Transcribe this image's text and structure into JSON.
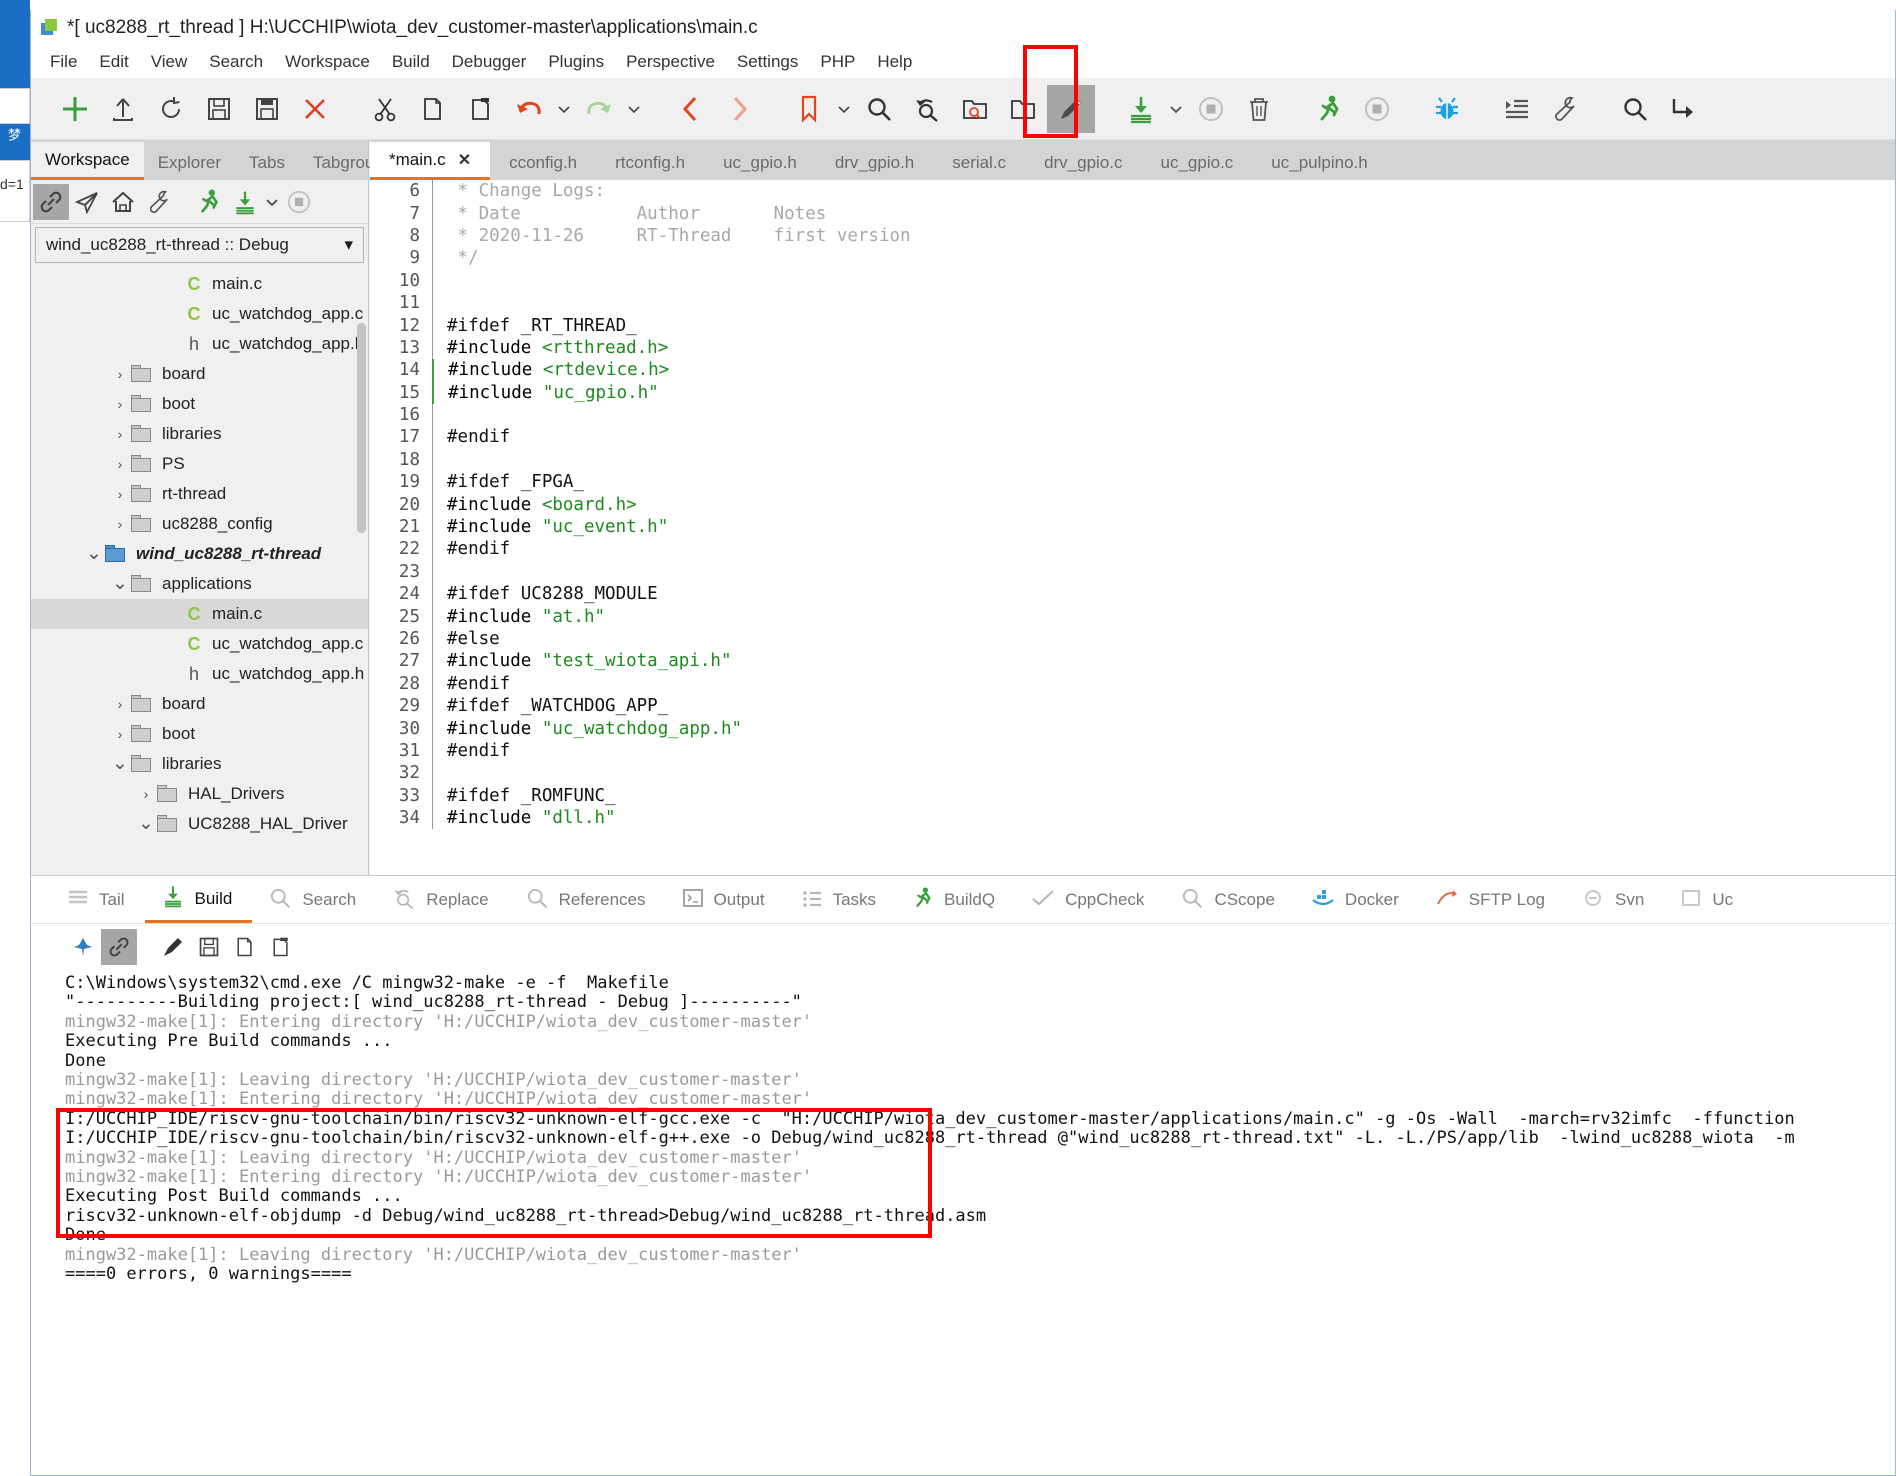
{
  "desktop": {
    "vertical_text": "梦",
    "partial_text": "d=1"
  },
  "window": {
    "title": "*[ uc8288_rt_thread ] H:\\UCCHIP\\wiota_dev_customer-master\\applications\\main.c",
    "icon": "app-icon"
  },
  "menubar": {
    "items": [
      "File",
      "Edit",
      "View",
      "Search",
      "Workspace",
      "Build",
      "Debugger",
      "Plugins",
      "Perspective",
      "Settings",
      "PHP",
      "Help"
    ]
  },
  "toolbar": {
    "items": [
      {
        "name": "new-file-button",
        "icon": "plus-icon",
        "color": "#3a9e3a"
      },
      {
        "name": "open-file-button",
        "icon": "upload-icon",
        "color": "#444444"
      },
      {
        "name": "reload-button",
        "icon": "refresh-icon",
        "color": "#444444"
      },
      {
        "name": "save-button",
        "icon": "save-icon",
        "color": "#444444"
      },
      {
        "name": "save-all-button",
        "icon": "save-all-icon",
        "color": "#444444"
      },
      {
        "name": "close-file-button",
        "icon": "close-x-icon",
        "color": "#e03c20"
      },
      {
        "name": "cut-button",
        "icon": "scissors-icon",
        "color": "#333333"
      },
      {
        "name": "copy-button",
        "icon": "copy-icon",
        "color": "#333333"
      },
      {
        "name": "paste-button",
        "icon": "paste-icon",
        "color": "#333333"
      },
      {
        "name": "undo-button",
        "icon": "undo-arrow-icon",
        "color": "#e0451e"
      },
      {
        "name": "redo-button",
        "icon": "redo-arrow-icon",
        "color": "#a8d49a"
      },
      {
        "name": "nav-back-button",
        "icon": "chevron-left-icon",
        "color": "#e0451e"
      },
      {
        "name": "nav-forward-button",
        "icon": "chevron-right-icon",
        "color": "#f0a189"
      },
      {
        "name": "bookmark-button",
        "icon": "bookmark-icon",
        "color": "#e0451e"
      },
      {
        "name": "find-button",
        "icon": "search-icon",
        "color": "#333333"
      },
      {
        "name": "replace-button",
        "icon": "find-replace-icon",
        "color": "#333333"
      },
      {
        "name": "find-in-files-button",
        "icon": "folder-search-icon",
        "color": "#333333"
      },
      {
        "name": "open-folder-button",
        "icon": "folder-open-icon",
        "color": "#333333"
      },
      {
        "name": "edit-mode-button",
        "icon": "pencil-icon",
        "color": "#4a4a4a"
      },
      {
        "name": "build-download-button",
        "icon": "download-build-icon",
        "color": "#3a9e3a"
      },
      {
        "name": "stop-build-button",
        "icon": "stop-circle-icon",
        "color": "#b0b0b0"
      },
      {
        "name": "clean-button",
        "icon": "trash-icon",
        "color": "#555555"
      },
      {
        "name": "run-button",
        "icon": "runner-icon",
        "color": "#3a9e3a"
      },
      {
        "name": "stop-run-button",
        "icon": "stop-circle-icon",
        "color": "#b0b0b0"
      },
      {
        "name": "debug-button",
        "icon": "bug-icon",
        "color": "#1e9fe0"
      },
      {
        "name": "indent-button",
        "icon": "indent-icon",
        "color": "#555555"
      },
      {
        "name": "settings-button",
        "icon": "wrench-icon",
        "color": "#555555"
      },
      {
        "name": "search2-button",
        "icon": "search-icon",
        "color": "#333333"
      },
      {
        "name": "goto-button",
        "icon": "goto-arrow-icon",
        "color": "#333333"
      }
    ],
    "highlighted_item": "build-download-button"
  },
  "left_panel": {
    "tabs": [
      {
        "label": "Workspace",
        "active": true
      },
      {
        "label": "Explorer",
        "active": false
      },
      {
        "label": "Tabs",
        "active": false
      },
      {
        "label": "Tabgrou",
        "active": false,
        "caret": "⌄"
      }
    ],
    "toolbar": [
      {
        "name": "link-button",
        "icon": "link-icon",
        "selected": true
      },
      {
        "name": "send-button",
        "icon": "paper-plane-icon",
        "selected": false
      },
      {
        "name": "home-button",
        "icon": "home-icon",
        "selected": false
      },
      {
        "name": "configure-button",
        "icon": "wrench-icon",
        "selected": false
      },
      {
        "name": "run-project-button",
        "icon": "runner-icon",
        "selected": false
      },
      {
        "name": "build-project-button",
        "icon": "download-build-icon",
        "selected": false
      },
      {
        "name": "stop-project-button",
        "icon": "stop-circle-icon",
        "selected": false
      }
    ],
    "project_selector": "wind_uc8288_rt-thread :: Debug",
    "tree": [
      {
        "label": "main.c",
        "type": "c",
        "indent": 4,
        "chev": "",
        "sel": false
      },
      {
        "label": "uc_watchdog_app.c",
        "type": "c",
        "indent": 4,
        "chev": "",
        "sel": false
      },
      {
        "label": "uc_watchdog_app.h",
        "type": "h",
        "indent": 4,
        "chev": "",
        "sel": false
      },
      {
        "label": "board",
        "type": "folder",
        "indent": 2,
        "chev": "›",
        "sel": false
      },
      {
        "label": "boot",
        "type": "folder",
        "indent": 2,
        "chev": "›",
        "sel": false
      },
      {
        "label": "libraries",
        "type": "folder",
        "indent": 2,
        "chev": "›",
        "sel": false
      },
      {
        "label": "PS",
        "type": "folder",
        "indent": 2,
        "chev": "›",
        "sel": false
      },
      {
        "label": "rt-thread",
        "type": "folder",
        "indent": 2,
        "chev": "›",
        "sel": false
      },
      {
        "label": "uc8288_config",
        "type": "folder",
        "indent": 2,
        "chev": "›",
        "sel": false
      },
      {
        "label": "wind_uc8288_rt-thread",
        "type": "folder-blue",
        "indent": 1,
        "chev": "⌄",
        "sel": false,
        "bold": true
      },
      {
        "label": "applications",
        "type": "folder",
        "indent": 2,
        "chev": "⌄",
        "sel": false
      },
      {
        "label": "main.c",
        "type": "c",
        "indent": 4,
        "chev": "",
        "sel": true
      },
      {
        "label": "uc_watchdog_app.c",
        "type": "c",
        "indent": 4,
        "chev": "",
        "sel": false
      },
      {
        "label": "uc_watchdog_app.h",
        "type": "h",
        "indent": 4,
        "chev": "",
        "sel": false
      },
      {
        "label": "board",
        "type": "folder",
        "indent": 2,
        "chev": "›",
        "sel": false
      },
      {
        "label": "boot",
        "type": "folder",
        "indent": 2,
        "chev": "›",
        "sel": false
      },
      {
        "label": "libraries",
        "type": "folder",
        "indent": 2,
        "chev": "⌄",
        "sel": false
      },
      {
        "label": "HAL_Drivers",
        "type": "folder",
        "indent": 3,
        "chev": "›",
        "sel": false
      },
      {
        "label": "UC8288_HAL_Driver",
        "type": "folder",
        "indent": 3,
        "chev": "⌄",
        "sel": false
      }
    ]
  },
  "editor": {
    "tabs": [
      {
        "label": "*main.c",
        "active": true,
        "closable": true,
        "close": "✕"
      },
      {
        "label": "cconfig.h",
        "active": false,
        "closable": false
      },
      {
        "label": "rtconfig.h",
        "active": false,
        "closable": false
      },
      {
        "label": "uc_gpio.h",
        "active": false,
        "closable": false
      },
      {
        "label": "drv_gpio.h",
        "active": false,
        "closable": false
      },
      {
        "label": "serial.c",
        "active": false,
        "closable": false
      },
      {
        "label": "drv_gpio.c",
        "active": false,
        "closable": false
      },
      {
        "label": "uc_gpio.c",
        "active": false,
        "closable": false
      },
      {
        "label": "uc_pulpino.h",
        "active": false,
        "closable": false
      }
    ],
    "lines": [
      {
        "num": 6,
        "text": " * Change Logs:",
        "style": "comment",
        "mark": "none"
      },
      {
        "num": 7,
        "text": " * Date           Author       Notes",
        "style": "comment",
        "mark": "none"
      },
      {
        "num": 8,
        "text": " * 2020-11-26     RT-Thread    first version",
        "style": "comment",
        "mark": "none"
      },
      {
        "num": 9,
        "text": " */",
        "style": "comment",
        "mark": "none"
      },
      {
        "num": 10,
        "text": "",
        "style": "code",
        "mark": "none"
      },
      {
        "num": 11,
        "text": "",
        "style": "code",
        "mark": "none"
      },
      {
        "num": 12,
        "text": "#ifdef _RT_THREAD_",
        "style": "code",
        "mark": "none"
      },
      {
        "num": 13,
        "text": "#include <rtthread.h>",
        "style": "include-angle",
        "mark": "none"
      },
      {
        "num": 14,
        "text": "#include <rtdevice.h>",
        "style": "include-angle",
        "mark": "green"
      },
      {
        "num": 15,
        "text": "#include \"uc_gpio.h\"",
        "style": "include-quote",
        "mark": "green"
      },
      {
        "num": 16,
        "text": "",
        "style": "code",
        "mark": "none"
      },
      {
        "num": 17,
        "text": "#endif",
        "style": "code",
        "mark": "none"
      },
      {
        "num": 18,
        "text": "",
        "style": "code",
        "mark": "none"
      },
      {
        "num": 19,
        "text": "#ifdef _FPGA_",
        "style": "code",
        "mark": "none"
      },
      {
        "num": 20,
        "text": "#include <board.h>",
        "style": "include-angle",
        "mark": "none"
      },
      {
        "num": 21,
        "text": "#include \"uc_event.h\"",
        "style": "include-quote",
        "mark": "none"
      },
      {
        "num": 22,
        "text": "#endif",
        "style": "code",
        "mark": "none"
      },
      {
        "num": 23,
        "text": "",
        "style": "code",
        "mark": "none"
      },
      {
        "num": 24,
        "text": "#ifdef UC8288_MODULE",
        "style": "code",
        "mark": "none"
      },
      {
        "num": 25,
        "text": "#include \"at.h\"",
        "style": "include-quote",
        "mark": "none"
      },
      {
        "num": 26,
        "text": "#else",
        "style": "code",
        "mark": "none"
      },
      {
        "num": 27,
        "text": "#include \"test_wiota_api.h\"",
        "style": "include-quote",
        "mark": "none"
      },
      {
        "num": 28,
        "text": "#endif",
        "style": "code",
        "mark": "none"
      },
      {
        "num": 29,
        "text": "#ifdef _WATCHDOG_APP_",
        "style": "code",
        "mark": "none"
      },
      {
        "num": 30,
        "text": "#include \"uc_watchdog_app.h\"",
        "style": "include-quote",
        "mark": "none"
      },
      {
        "num": 31,
        "text": "#endif",
        "style": "code",
        "mark": "none"
      },
      {
        "num": 32,
        "text": "",
        "style": "code",
        "mark": "none"
      },
      {
        "num": 33,
        "text": "#ifdef _ROMFUNC_",
        "style": "code",
        "mark": "none"
      },
      {
        "num": 34,
        "text": "#include \"dll.h\"",
        "style": "include-quote",
        "mark": "none"
      }
    ]
  },
  "bottom_panel": {
    "tabs": [
      {
        "label": "Tail",
        "icon": "list-icon",
        "active": false
      },
      {
        "label": "Build",
        "icon": "download-build-icon",
        "active": true
      },
      {
        "label": "Search",
        "icon": "search-icon",
        "active": false
      },
      {
        "label": "Replace",
        "icon": "find-replace-icon",
        "active": false
      },
      {
        "label": "References",
        "icon": "search-icon",
        "active": false
      },
      {
        "label": "Output",
        "icon": "terminal-icon",
        "active": false
      },
      {
        "label": "Tasks",
        "icon": "tasks-icon",
        "active": false
      },
      {
        "label": "BuildQ",
        "icon": "runner-icon",
        "active": false
      },
      {
        "label": "CppCheck",
        "icon": "check-icon",
        "active": false
      },
      {
        "label": "CScope",
        "icon": "search-icon",
        "active": false
      },
      {
        "label": "Docker",
        "icon": "docker-icon",
        "active": false
      },
      {
        "label": "SFTP Log",
        "icon": "sftp-icon",
        "active": false
      },
      {
        "label": "Svn",
        "icon": "svn-icon",
        "active": false
      },
      {
        "label": "Uc",
        "icon": "uc-icon",
        "active": false
      }
    ],
    "toolbar": [
      {
        "name": "pin-button",
        "icon": "pin-icon",
        "selected": false
      },
      {
        "name": "link-button",
        "icon": "link-icon",
        "selected": true
      },
      {
        "name": "clear-console-button",
        "icon": "broom-icon",
        "selected": false
      },
      {
        "name": "save-console-button",
        "icon": "save-icon",
        "selected": false
      },
      {
        "name": "copy-console-button",
        "icon": "copy-icon",
        "selected": false
      },
      {
        "name": "copy-all-button",
        "icon": "paste-icon",
        "selected": false
      }
    ],
    "console_lines": [
      {
        "text": "C:\\Windows\\system32\\cmd.exe /C mingw32-make -e -f  Makefile",
        "dim": false
      },
      {
        "text": "\"----------Building project:[ wind_uc8288_rt-thread - Debug ]----------\"",
        "dim": false
      },
      {
        "text": "mingw32-make[1]: Entering directory 'H:/UCCHIP/wiota_dev_customer-master'",
        "dim": true
      },
      {
        "text": "Executing Pre Build commands ...",
        "dim": false
      },
      {
        "text": "Done",
        "dim": false
      },
      {
        "text": "mingw32-make[1]: Leaving directory 'H:/UCCHIP/wiota_dev_customer-master'",
        "dim": true
      },
      {
        "text": "mingw32-make[1]: Entering directory 'H:/UCCHIP/wiota_dev_customer-master'",
        "dim": true
      },
      {
        "text": "I:/UCCHIP_IDE/riscv-gnu-toolchain/bin/riscv32-unknown-elf-gcc.exe -c  \"H:/UCCHIP/wiota_dev_customer-master/applications/main.c\" -g -Os -Wall  -march=rv32imfc  -ffunction",
        "dim": false
      },
      {
        "text": "I:/UCCHIP_IDE/riscv-gnu-toolchain/bin/riscv32-unknown-elf-g++.exe -o Debug/wind_uc8288_rt-thread @\"wind_uc8288_rt-thread.txt\" -L. -L./PS/app/lib  -lwind_uc8288_wiota  -m",
        "dim": false
      },
      {
        "text": "mingw32-make[1]: Leaving directory 'H:/UCCHIP/wiota_dev_customer-master'",
        "dim": true
      },
      {
        "text": "mingw32-make[1]: Entering directory 'H:/UCCHIP/wiota_dev_customer-master'",
        "dim": true
      },
      {
        "text": "Executing Post Build commands ...",
        "dim": false
      },
      {
        "text": "riscv32-unknown-elf-objdump -d Debug/wind_uc8288_rt-thread>Debug/wind_uc8288_rt-thread.asm",
        "dim": false
      },
      {
        "text": "Done",
        "dim": false
      },
      {
        "text": "mingw32-make[1]: Leaving directory 'H:/UCCHIP/wiota_dev_customer-master'",
        "dim": true
      },
      {
        "text": "====0 errors, 0 warnings====",
        "dim": false
      }
    ],
    "highlight_color": "#ff0000"
  }
}
